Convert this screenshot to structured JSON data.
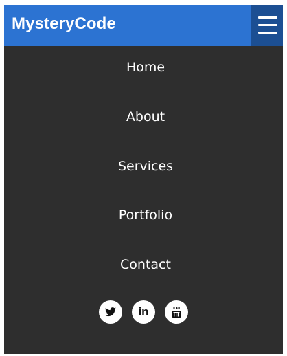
{
  "header": {
    "brand": "MysteryCode",
    "background_color": "#2c73d2",
    "menu_button_color": "#1c4f93",
    "menu_icon": "hamburger-menu-icon"
  },
  "nav": {
    "background_color": "#2e2e2e",
    "items": [
      {
        "label": "Home"
      },
      {
        "label": "About"
      },
      {
        "label": "Services"
      },
      {
        "label": "Portfolio"
      },
      {
        "label": "Contact"
      }
    ]
  },
  "social": {
    "icons": [
      {
        "name": "twitter-icon"
      },
      {
        "name": "linkedin-icon",
        "text": "in"
      },
      {
        "name": "youtube-icon"
      }
    ]
  }
}
